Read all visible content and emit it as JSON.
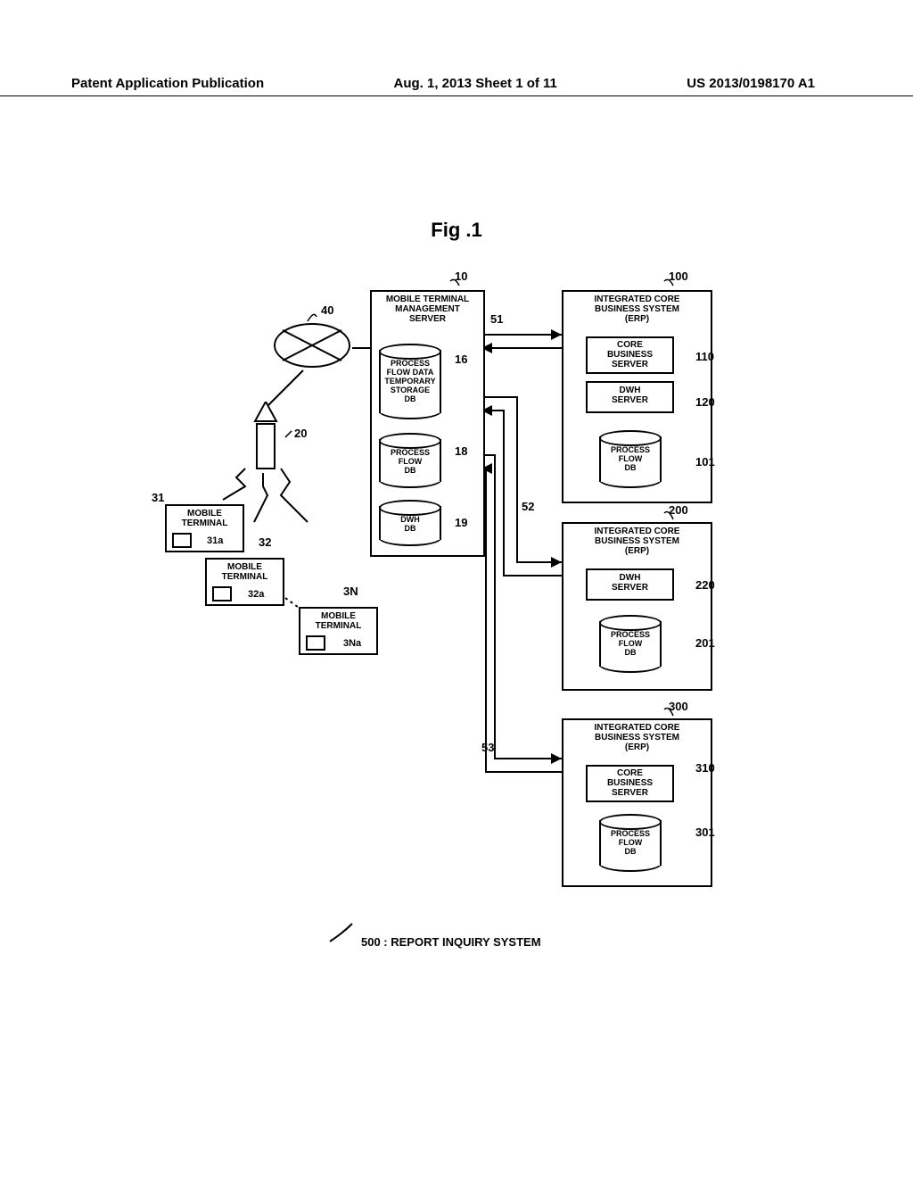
{
  "header": {
    "left": "Patent Application Publication",
    "center": "Aug. 1, 2013   Sheet 1 of 11",
    "right": "US 2013/0198170 A1"
  },
  "figure_title": "Fig .1",
  "blocks": {
    "mgmt_server": "MOBILE TERMINAL\nMANAGEMENT\nSERVER",
    "db16": "PROCESS\nFLOW DATA\nTEMPORARY\nSTORAGE\nDB",
    "db18": "PROCESS\nFLOW\nDB",
    "db19": "DWH\nDB",
    "erp": "INTEGRATED CORE\nBUSINESS SYSTEM\n(ERP)",
    "core_srv": "CORE\nBUSINESS\nSERVER",
    "dwh_srv": "DWH\nSERVER",
    "proc_flow_db": "PROCESS\nFLOW\nDB",
    "mobile_term": "MOBILE\nTERMINAL"
  },
  "refs": {
    "r10": "10",
    "r40": "40",
    "r20": "20",
    "r16": "16",
    "r18": "18",
    "r19": "19",
    "r51": "51",
    "r52": "52",
    "r53": "53",
    "r31": "31",
    "r31a": "31a",
    "r32": "32",
    "r32a": "32a",
    "r3N": "3N",
    "r3Na": "3Na",
    "r100": "100",
    "r110": "110",
    "r120": "120",
    "r101": "101",
    "r200": "200",
    "r220": "220",
    "r201": "201",
    "r300": "300",
    "r310": "310",
    "r301": "301"
  },
  "footer": "500 : REPORT INQUIRY SYSTEM",
  "chart_data": {
    "type": "diagram",
    "title": "Fig. 1 — Report Inquiry System (ref 500)",
    "nodes": [
      {
        "id": "40",
        "label": "Satellite / Network node"
      },
      {
        "id": "20",
        "label": "Base station"
      },
      {
        "id": "31",
        "label": "MOBILE TERMINAL",
        "children": [
          {
            "id": "31a"
          }
        ]
      },
      {
        "id": "32",
        "label": "MOBILE TERMINAL",
        "children": [
          {
            "id": "32a"
          }
        ]
      },
      {
        "id": "3N",
        "label": "MOBILE TERMINAL",
        "children": [
          {
            "id": "3Na"
          }
        ]
      },
      {
        "id": "10",
        "label": "MOBILE TERMINAL MANAGEMENT SERVER",
        "children": [
          {
            "id": "16",
            "label": "PROCESS FLOW DATA TEMPORARY STORAGE DB"
          },
          {
            "id": "18",
            "label": "PROCESS FLOW DB"
          },
          {
            "id": "19",
            "label": "DWH DB"
          }
        ]
      },
      {
        "id": "100",
        "label": "INTEGRATED CORE BUSINESS SYSTEM (ERP)",
        "children": [
          {
            "id": "110",
            "label": "CORE BUSINESS SERVER"
          },
          {
            "id": "120",
            "label": "DWH SERVER"
          },
          {
            "id": "101",
            "label": "PROCESS FLOW DB"
          }
        ]
      },
      {
        "id": "200",
        "label": "INTEGRATED CORE BUSINESS SYSTEM (ERP)",
        "children": [
          {
            "id": "220",
            "label": "DWH SERVER"
          },
          {
            "id": "201",
            "label": "PROCESS FLOW DB"
          }
        ]
      },
      {
        "id": "300",
        "label": "INTEGRATED CORE BUSINESS SYSTEM (ERP)",
        "children": [
          {
            "id": "310",
            "label": "CORE BUSINESS SERVER"
          },
          {
            "id": "301",
            "label": "PROCESS FLOW DB"
          }
        ]
      }
    ],
    "connections": [
      {
        "from": "40",
        "to": "20"
      },
      {
        "from": "20",
        "to": "31",
        "style": "wireless"
      },
      {
        "from": "20",
        "to": "32",
        "style": "wireless"
      },
      {
        "from": "20",
        "to": "3N",
        "style": "wireless"
      },
      {
        "from": "40",
        "to": "10"
      },
      {
        "id": "51",
        "from": "10",
        "to": "100",
        "style": "bidirectional"
      },
      {
        "id": "52",
        "from": "10",
        "to": "200",
        "style": "bidirectional"
      },
      {
        "id": "53",
        "from": "10",
        "to": "300",
        "style": "bidirectional"
      }
    ]
  }
}
